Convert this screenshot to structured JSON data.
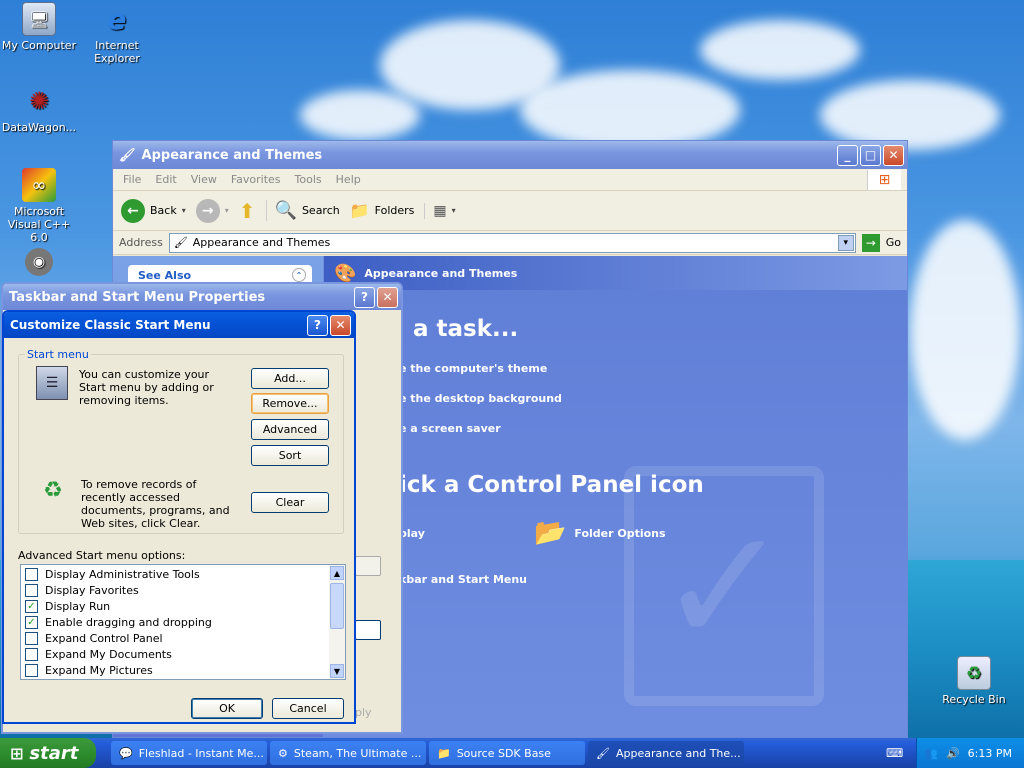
{
  "desktop": {
    "icons": [
      {
        "label": "My Computer"
      },
      {
        "label": "Internet Explorer"
      },
      {
        "label": "DataWagon..."
      },
      {
        "label": "Microsoft Visual C++ 6.0"
      },
      {
        "label": "Recycle Bin"
      }
    ]
  },
  "explorer": {
    "title": "Appearance and Themes",
    "menu": [
      "File",
      "Edit",
      "View",
      "Favorites",
      "Tools",
      "Help"
    ],
    "toolbar": {
      "back": "Back",
      "search": "Search",
      "folders": "Folders"
    },
    "address_label": "Address",
    "address_value": "Appearance and Themes",
    "go_label": "Go",
    "panel_header": "Appearance and Themes",
    "side_header": "See Also",
    "pick_task": "a task...",
    "tasks": [
      "e the computer's theme",
      "e the desktop background",
      "e a screen saver"
    ],
    "pick_icon": "ick a Control Panel icon",
    "icon_items": [
      "play",
      "Folder Options",
      "kbar and Start Menu"
    ]
  },
  "taskbar_props": {
    "title": "Taskbar and Start Menu Properties",
    "apply_fragment": "ply"
  },
  "customize": {
    "title": "Customize Classic Start Menu",
    "group_label": "Start menu",
    "description": "You can customize your Start menu by adding or removing items.",
    "clear_description": "To remove records of recently accessed documents, programs, and Web sites, click Clear.",
    "buttons": {
      "add": "Add...",
      "remove": "Remove...",
      "advanced": "Advanced",
      "sort": "Sort",
      "clear": "Clear",
      "ok": "OK",
      "cancel": "Cancel"
    },
    "advanced_label": "Advanced Start menu options:",
    "options": [
      {
        "label": "Display Administrative Tools",
        "checked": false
      },
      {
        "label": "Display Favorites",
        "checked": false
      },
      {
        "label": "Display Run",
        "checked": true
      },
      {
        "label": "Enable dragging and dropping",
        "checked": true
      },
      {
        "label": "Expand Control Panel",
        "checked": false
      },
      {
        "label": "Expand My Documents",
        "checked": false
      },
      {
        "label": "Expand My Pictures",
        "checked": false
      }
    ]
  },
  "taskbar": {
    "start_label": "start",
    "tasks": [
      {
        "label": "Fleshlad - Instant Me..."
      },
      {
        "label": "Steam, The Ultimate ..."
      },
      {
        "label": "Source SDK Base"
      },
      {
        "label": "Appearance and The..."
      }
    ],
    "clock": "6:13 PM"
  }
}
